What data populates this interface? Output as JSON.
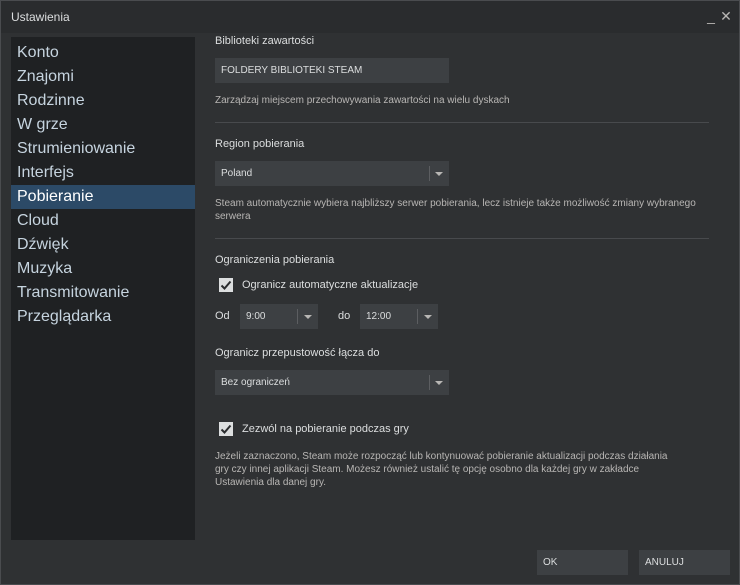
{
  "window": {
    "title": "Ustawienia",
    "minimize_symbol": "_",
    "close_symbol": "✕"
  },
  "sidebar": {
    "items": [
      {
        "label": "Konto"
      },
      {
        "label": "Znajomi"
      },
      {
        "label": "Rodzinne"
      },
      {
        "label": "W grze"
      },
      {
        "label": "Strumieniowanie"
      },
      {
        "label": "Interfejs"
      },
      {
        "label": "Pobieranie",
        "active": true
      },
      {
        "label": "Cloud"
      },
      {
        "label": "Dźwięk"
      },
      {
        "label": "Muzyka"
      },
      {
        "label": "Transmitowanie"
      },
      {
        "label": "Przeglądarka"
      }
    ]
  },
  "libraries": {
    "title": "Biblioteki zawartości",
    "button_label": "FOLDERY BIBLIOTEKI STEAM",
    "description": "Zarządzaj miejscem przechowywania zawartości na wielu dyskach"
  },
  "region": {
    "title": "Region pobierania",
    "selected": "Poland",
    "description": "Steam automatycznie wybiera najbliższy serwer pobierania, lecz istnieje także możliwość zmiany wybranego serwera"
  },
  "limits": {
    "title": "Ograniczenia pobierania",
    "auto_update_label": "Ogranicz automatyczne aktualizacje",
    "auto_update_checked": true,
    "from_label": "Od",
    "from_value": "9:00",
    "to_label": "do",
    "to_value": "12:00",
    "bandwidth_label": "Ogranicz przepustowość łącza do",
    "bandwidth_value": "Bez ograniczeń",
    "ingame_label": "Zezwól na pobieranie podczas gry",
    "ingame_checked": true,
    "ingame_description": "Jeżeli zaznaczono, Steam może rozpocząć lub kontynuować pobieranie aktualizacji podczas działania gry czy innej aplikacji Steam. Możesz również ustalić tę opcję osobno dla każdej gry w zakładce Ustawienia dla danej gry."
  },
  "footer": {
    "ok_label": "OK",
    "cancel_label": "ANULUJ"
  },
  "colors": {
    "accent_active": "#2c4a67",
    "panel": "#2f3133",
    "sidebar": "#1f2123"
  },
  "icons": {
    "dropdown": "chevron-down-icon",
    "checkbox": "checkmark-icon"
  }
}
